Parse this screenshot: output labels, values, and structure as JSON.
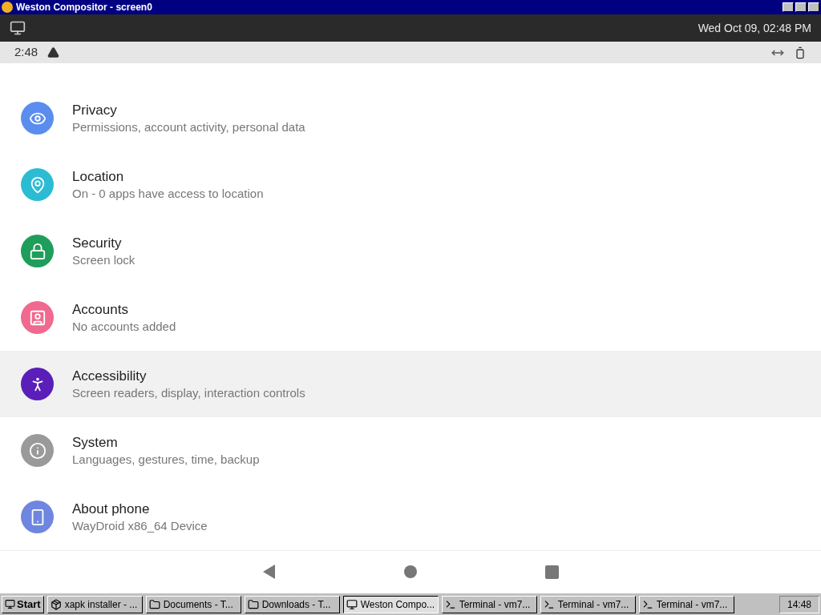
{
  "window": {
    "title": "Weston Compositor - screen0"
  },
  "weston_bar": {
    "clock": "Wed Oct 09, 02:48 PM"
  },
  "status_bar": {
    "time": "2:48"
  },
  "settings": [
    {
      "kind": "privacy",
      "title": "Privacy",
      "summary": "Permissions, account activity, personal data",
      "color": "#5b8def",
      "selected": false
    },
    {
      "kind": "location",
      "title": "Location",
      "summary": "On - 0 apps have access to location",
      "color": "#2bbcd4",
      "selected": false
    },
    {
      "kind": "security",
      "title": "Security",
      "summary": "Screen lock",
      "color": "#1e9e5a",
      "selected": false
    },
    {
      "kind": "accounts",
      "title": "Accounts",
      "summary": "No accounts added",
      "color": "#ef6a8e",
      "selected": false
    },
    {
      "kind": "accessibility",
      "title": "Accessibility",
      "summary": "Screen readers, display, interaction controls",
      "color": "#5a1fb8",
      "selected": true
    },
    {
      "kind": "system",
      "title": "System",
      "summary": "Languages, gestures, time, backup",
      "color": "#9a9a9a",
      "selected": false
    },
    {
      "kind": "about",
      "title": "About phone",
      "summary": "WayDroid x86_64 Device",
      "color": "#6f86e0",
      "selected": false
    }
  ],
  "taskbar": {
    "start": "Start",
    "clock": "14:48",
    "items": [
      {
        "kind": "app",
        "label": "xapk installer - ...",
        "selected": false
      },
      {
        "kind": "folder",
        "label": "Documents - T...",
        "selected": false
      },
      {
        "kind": "folder",
        "label": "Downloads - T...",
        "selected": false
      },
      {
        "kind": "weston",
        "label": "Weston Compo...",
        "selected": true
      },
      {
        "kind": "terminal",
        "label": "Terminal - vm7...",
        "selected": false
      },
      {
        "kind": "terminal",
        "label": "Terminal - vm7...",
        "selected": false
      },
      {
        "kind": "terminal",
        "label": "Terminal - vm7...",
        "selected": false
      }
    ]
  }
}
